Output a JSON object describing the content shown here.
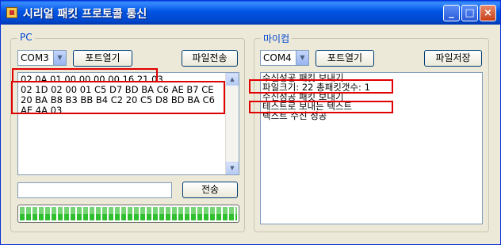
{
  "window": {
    "title": "시리얼 패킷 프로토콜 통신",
    "accent_color": "#0054e3"
  },
  "titlebar_buttons": {
    "minimize": "_",
    "maximize": "□",
    "close": "×"
  },
  "pc": {
    "group_label": "PC",
    "port_value": "COM3",
    "open_port_label": "포트열기",
    "send_file_label": "파일전송",
    "log_text": "02 0A 01 00 00 00 00 16 21 03\n02 1D 02 00 01 C5 D7 BD BA C6 AE B7 CE 20 BA B8 B3 BB B4 C2 20 C5 D8 BD BA C6 AE 4A 03",
    "send_input_value": "",
    "send_label": "전송",
    "progress": 1.0
  },
  "mycom": {
    "group_label": "마이컴",
    "port_value": "COM4",
    "open_port_label": "포트열기",
    "save_file_label": "파일저장",
    "log_lines": [
      "수신성공 패킷 보내기",
      "파일크기: 22  총패킷갯수: 1",
      "수신성공 패킷 보내기",
      "테스트로 보내는 텍스트",
      "텍스트 수신 성공"
    ]
  },
  "highlight_color": "#e00000"
}
